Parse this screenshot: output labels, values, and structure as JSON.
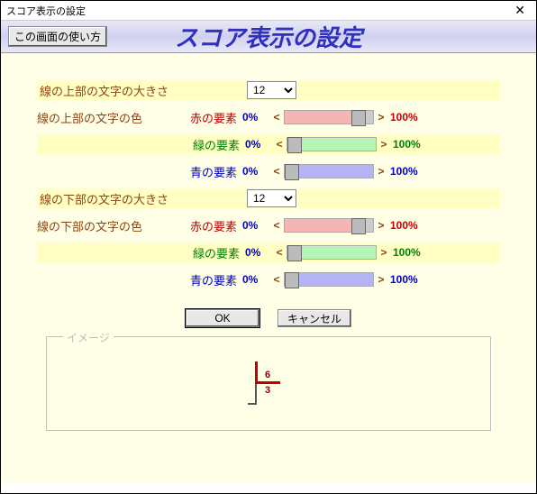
{
  "window": {
    "title": "スコア表示の設定",
    "big_title": "スコア表示の設定"
  },
  "help_button": "この画面の使い方",
  "labels": {
    "top_size": "線の上部の文字の大きさ",
    "top_color": "線の上部の文字の色",
    "bot_size": "線の下部の文字の大きさ",
    "bot_color": "線の下部の文字の色"
  },
  "components": {
    "red": "赤の要素",
    "green": "緑の要素",
    "blue": "青の要素"
  },
  "size": {
    "top": "12",
    "bot": "12"
  },
  "pct": {
    "zero": "0%",
    "hundred": "100%"
  },
  "sliders": {
    "top_red": 78,
    "top_green": 0,
    "top_blue": 0,
    "bot_red": 78,
    "bot_green": 0,
    "bot_blue": 0
  },
  "buttons": {
    "ok": "OK",
    "cancel": "キャンセル"
  },
  "fieldset": {
    "legend": "イメージ"
  },
  "preview": {
    "top_num": "6",
    "bot_num": "3"
  }
}
